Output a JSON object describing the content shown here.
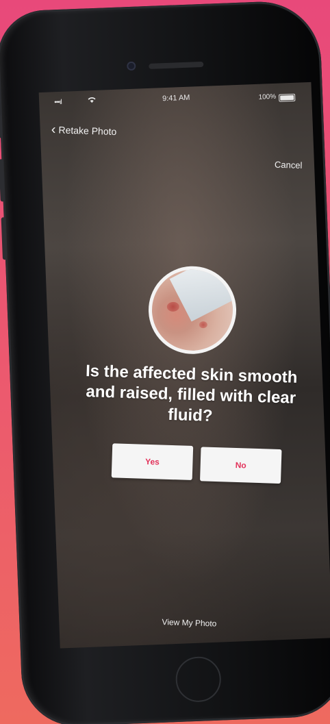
{
  "status_bar": {
    "signal": "•••ıl",
    "wifi_icon": "wifi-icon",
    "time": "9:41 AM",
    "battery_percent": "100%"
  },
  "nav": {
    "back_label": "Retake Photo",
    "cancel_label": "Cancel"
  },
  "question": {
    "text": "Is the affected skin smooth and raised, filled with clear fluid?"
  },
  "answers": {
    "yes_label": "Yes",
    "no_label": "No"
  },
  "footer": {
    "view_photo_label": "View My Photo"
  },
  "colors": {
    "accent": "#e2335b",
    "background_top": "#e8497a",
    "background_bottom": "#ee6a5f"
  }
}
